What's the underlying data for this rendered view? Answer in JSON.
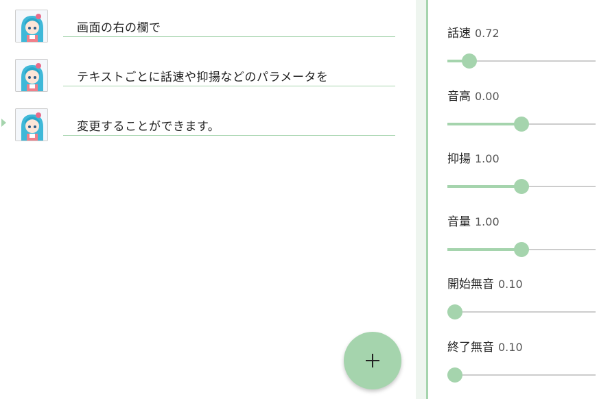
{
  "cells": [
    {
      "text": "画面の右の欄で",
      "active": false
    },
    {
      "text": "テキストごとに話速や抑揚などのパラメータを",
      "active": false
    },
    {
      "text": "変更することができます。",
      "active": true
    }
  ],
  "add_button": {
    "icon": "plus-icon"
  },
  "parameters": [
    {
      "name": "話速",
      "value": "0.72",
      "position": 0.15
    },
    {
      "name": "音高",
      "value": "0.00",
      "position": 0.5
    },
    {
      "name": "抑揚",
      "value": "1.00",
      "position": 0.5
    },
    {
      "name": "音量",
      "value": "1.00",
      "position": 0.5
    },
    {
      "name": "開始無音",
      "value": "0.10",
      "position": 0.05
    },
    {
      "name": "終了無音",
      "value": "0.10",
      "position": 0.05
    }
  ],
  "colors": {
    "accent": "#a5d4ad",
    "track": "#cccccc",
    "panel_bg": "#eef5ef"
  }
}
